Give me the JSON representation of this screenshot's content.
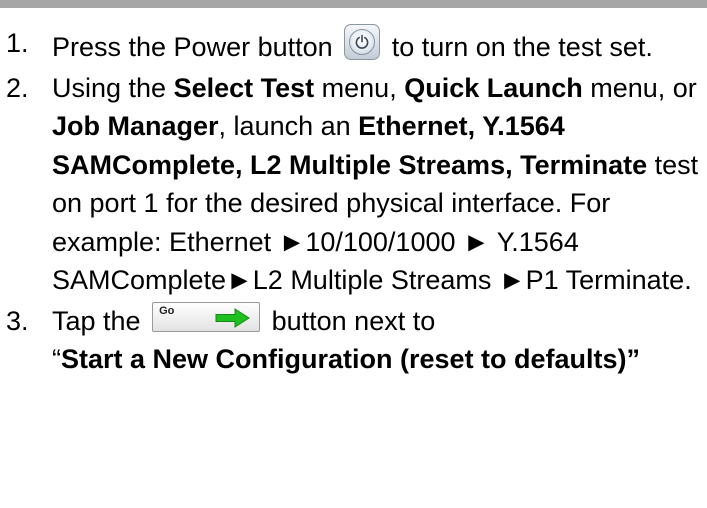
{
  "steps": [
    {
      "number": "1.",
      "text_before_icon": "Press the Power button",
      "text_after_icon": "to turn on the test set.",
      "icon": "power-icon"
    },
    {
      "number": "2.",
      "parts": [
        "Using the ",
        "Select Test",
        " menu, ",
        "Quick Launch",
        " menu, or ",
        "Job Manager",
        ", launch an ",
        "Ethernet, Y.1564 SAMComplete, L2 Multiple Streams, Terminate",
        " test on port 1 for the desired physical interface.  For example: Ethernet ►10/100/1000 ► Y.1564 SAMComplete►L2 Multiple Streams ►P1 Terminate."
      ]
    },
    {
      "number": "3.",
      "text_before_icon": "Tap the",
      "go_label": "Go",
      "text_after_icon": "button next to",
      "quote_open": "“",
      "bold_text": "Start a New Configuration (reset to defaults)”",
      "icon": "green-arrow-icon"
    }
  ],
  "colors": {
    "top_bar": "#a6a6a6",
    "go_arrow": "#1fbf1f",
    "power_glyph": "#3c4650"
  }
}
